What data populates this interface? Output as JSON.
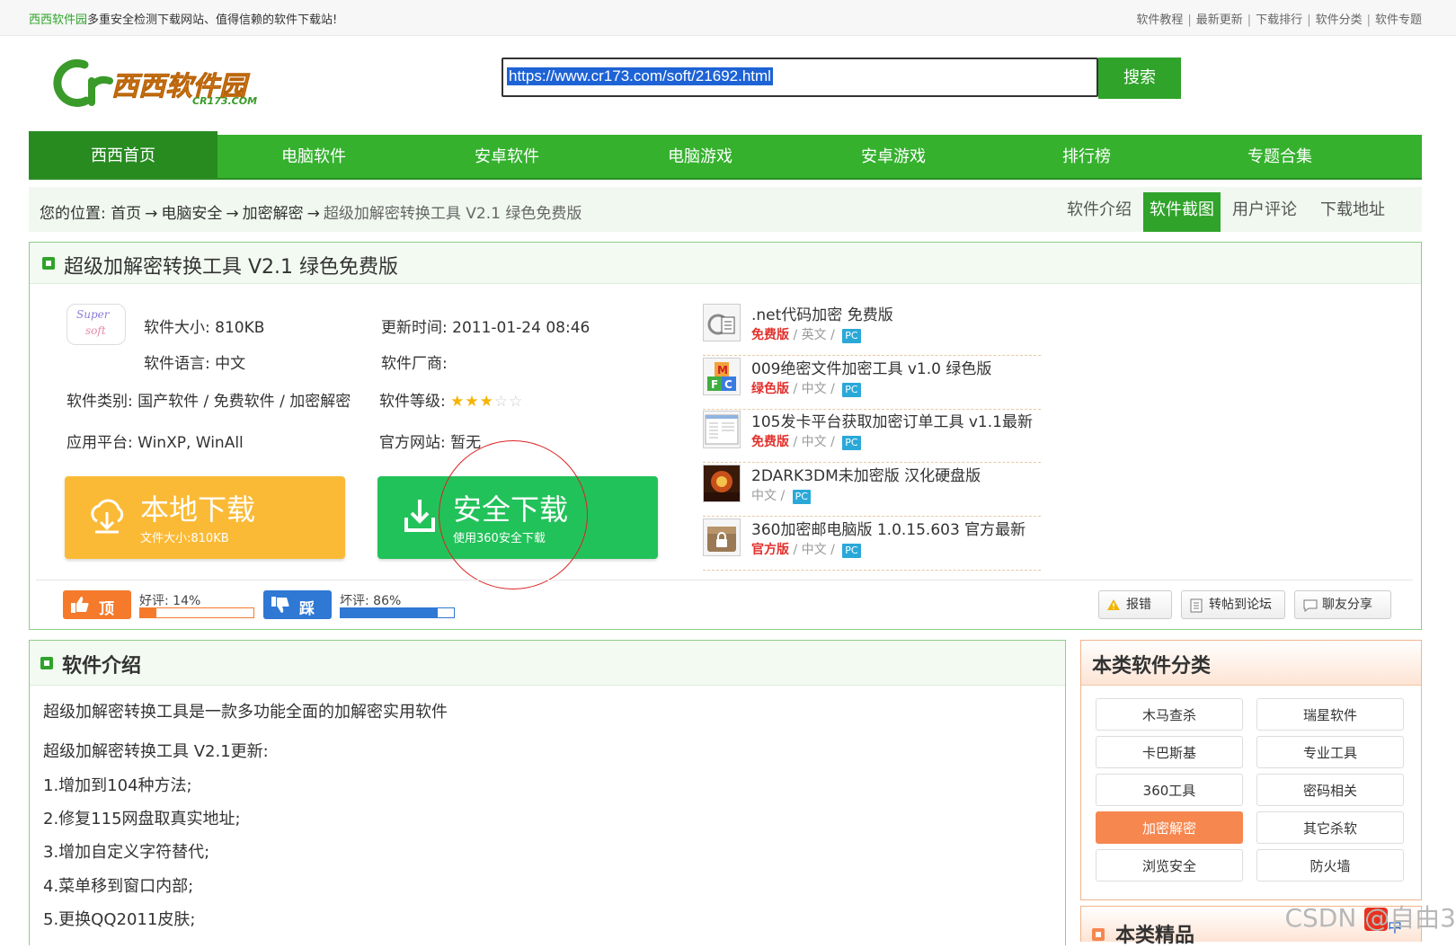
{
  "topbar": {
    "site": "西西软件园",
    "slogan": "多重安全检测下载网站、值得信赖的软件下载站!",
    "links": [
      "软件教程",
      "最新更新",
      "下载排行",
      "软件分类",
      "软件专题"
    ]
  },
  "search": {
    "value": "https://www.cr173.com/soft/21692.html",
    "button": "搜索"
  },
  "logo": {
    "en": "Cr",
    "cn": "西西软件园",
    "domain": "CR173.COM"
  },
  "nav": [
    "西西首页",
    "电脑软件",
    "安卓软件",
    "电脑游戏",
    "安卓游戏",
    "排行榜",
    "专题合集"
  ],
  "breadcrumb": {
    "prefix": "您的位置:",
    "items": [
      "首页",
      "电脑安全",
      "加密解密"
    ],
    "current": "超级加解密转换工具 V2.1 绿色免费版",
    "arrow": "→"
  },
  "content_tabs": [
    "软件介绍",
    "软件截图",
    "用户评论",
    "下载地址"
  ],
  "title": "超级加解密转换工具  V2.1 绿色免费版",
  "logo_text": [
    "Super",
    "soft"
  ],
  "info": {
    "size": "软件大小: 810KB",
    "language": "软件语言: 中文",
    "category": "软件类别: 国产软件 / 免费软件 / 加密解密",
    "platform": "应用平台: WinXP, WinAll",
    "updated": "更新时间: 2011-01-24 08:46",
    "vendor": "软件厂商:",
    "level_label": "软件等级:",
    "level_stars": 3,
    "level_max": 5,
    "website": "官方网站: 暂无"
  },
  "downloads": {
    "local_title": "本地下载",
    "local_sub": "文件大小:810KB",
    "safe_title": "安全下载",
    "safe_sub": "使用360安全下载"
  },
  "related": [
    {
      "title": ".net代码加密 免费版",
      "tag": "免费版",
      "lang": "英文",
      "pc": "PC",
      "icon": "document-gear-icon"
    },
    {
      "title": "009绝密文件加密工具 v1.0 绿色版",
      "tag": "绿色版",
      "lang": "中文",
      "pc": "PC",
      "icon": "mfc-blocks-icon"
    },
    {
      "title": "105发卡平台获取加密订单工具 v1.1最新",
      "tag": "免费版",
      "lang": "中文",
      "pc": "PC",
      "icon": "window-screenshot-icon"
    },
    {
      "title": "2DARK3DM未加密版 汉化硬盘版",
      "tag": "",
      "lang": "中文",
      "pc": "PC",
      "icon": "game-cover-icon"
    },
    {
      "title": "360加密邮电脑版 1.0.15.603 官方最新",
      "tag": "官方版",
      "lang": "中文",
      "pc": "PC",
      "icon": "lock-box-icon"
    }
  ],
  "vote": {
    "up_label": "顶",
    "down_label": "踩",
    "good": "好评: 14%",
    "good_value": 0.14,
    "bad": "坏评: 86%",
    "bad_value": 0.86
  },
  "actions": [
    "报错",
    "转帖到论坛",
    "聊友分享"
  ],
  "intro": {
    "title": "软件介绍",
    "lines": [
      " 超级加解密转换工具是一款多功能全面的加解密实用软件",
      "超级加解密转换工具 V2.1更新:",
      "1.增加到104种方法;",
      "2.修复115网盘取真实地址;",
      "3.增加自定义字符替代;",
      "4.菜单移到窗口内部;",
      "5.更换QQ2011皮肤;"
    ]
  },
  "sidebar": {
    "title": "本类软件分类",
    "categories": [
      "木马查杀",
      "瑞星软件",
      "卡巴斯基",
      "专业工具",
      "360工具",
      "密码相关",
      "加密解密",
      "其它杀软",
      "浏览安全",
      "防火墙"
    ],
    "active": "加密解密",
    "next_title": "本类精品"
  },
  "watermark": "CSDN @自由3",
  "ime": "中",
  "colors": {
    "brand_green": "#35b12e",
    "orange": "#fbba36",
    "safe_green": "#22c25a",
    "tag_red": "#e2312d",
    "pc_blue": "#2aa8d8"
  }
}
